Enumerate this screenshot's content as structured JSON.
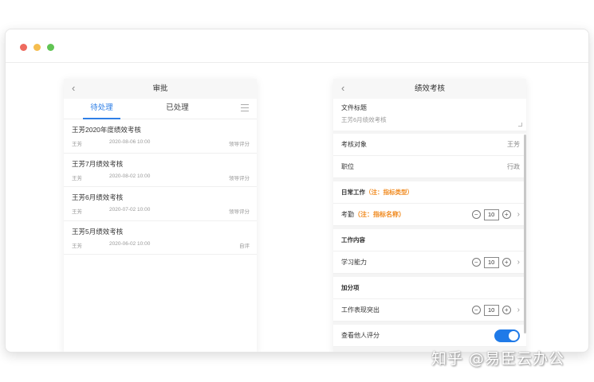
{
  "left_phone": {
    "title": "审批",
    "back_icon": "‹",
    "tabs": [
      {
        "label": "待处理",
        "active": true
      },
      {
        "label": "已处理",
        "active": false
      }
    ],
    "items": [
      {
        "title": "王芳2020年度绩效考核",
        "person": "王芳",
        "time": "2020-08-06  10:00",
        "status": "领导评分"
      },
      {
        "title": "王芳7月绩效考核",
        "person": "王芳",
        "time": "2020-08-02  10:00",
        "status": "领导评分"
      },
      {
        "title": "王芳6月绩效考核",
        "person": "王芳",
        "time": "2020-07-02  10:00",
        "status": "领导评分"
      },
      {
        "title": "王芳5月绩效考核",
        "person": "王芳",
        "time": "2020-06-02  10:00",
        "status": "自评"
      }
    ]
  },
  "right_phone": {
    "title": "绩效考核",
    "back_icon": "‹",
    "doc_title_label": "文件标题",
    "doc_title_value": "王芳6月绩效考核",
    "target_label": "考核对象",
    "target_value": "王芳",
    "position_label": "职位",
    "position_value": "行政",
    "section1": {
      "label": "日常工作",
      "note": "（注：指标类型）"
    },
    "attendance": {
      "label": "考勤",
      "note": "（注：指标名称）",
      "value": "10"
    },
    "section2": {
      "label": "工作内容"
    },
    "learning": {
      "label": "学习能力",
      "value": "10"
    },
    "section3": {
      "label": "加分项"
    },
    "performance": {
      "label": "工作表现突出",
      "value": "10"
    },
    "view_others_label": "查看他人评分"
  },
  "watermark": "知乎 @易臣云办公",
  "colors": {
    "accent": "#2f7fe6",
    "orange": "#f08a1f",
    "toggle": "#1f7ae8"
  }
}
